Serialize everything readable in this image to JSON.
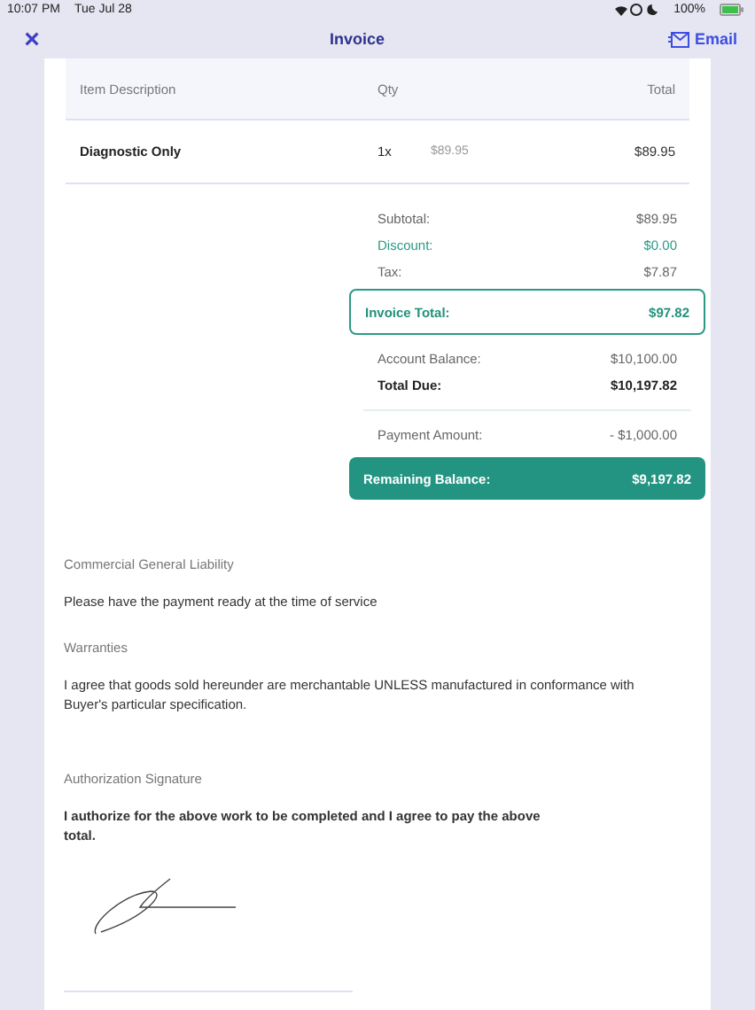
{
  "status_bar": {
    "time": "10:07 PM",
    "date": "Tue Jul 28",
    "battery": "100%"
  },
  "nav": {
    "close": "×",
    "title": "Invoice",
    "action": "Email"
  },
  "table": {
    "columns": [
      "Item Description",
      "Qty",
      "Total"
    ],
    "rows": [
      {
        "description": "Diagnostic Only",
        "qty": "1x",
        "unit_price": "$89.95",
        "total": "$89.95"
      }
    ]
  },
  "summary": [
    {
      "kind": "plain",
      "label": "Subtotal:",
      "value": "$89.95"
    },
    {
      "kind": "discount",
      "label": "Discount:",
      "value": "$0.00"
    },
    {
      "kind": "plain",
      "label": "Tax:",
      "value": "$7.87"
    },
    {
      "kind": "outlined",
      "label": "Invoice Total:",
      "value": "$97.82"
    },
    {
      "kind": "plain",
      "label": "Account Balance:",
      "value": "$10,100.00"
    },
    {
      "kind": "bold",
      "label": "Total Due:",
      "value": "$10,197.82"
    },
    {
      "kind": "divider"
    },
    {
      "kind": "plain",
      "label": "Payment Amount:",
      "value": "- $1,000.00"
    },
    {
      "kind": "filled",
      "label": "Remaining Balance:",
      "value": "$9,197.82"
    }
  ],
  "sections": [
    {
      "heading": "Commercial General Liability",
      "body": "Please have the payment ready at the time of service",
      "emphasis": false
    },
    {
      "heading": "Warranties",
      "body": "I agree that goods sold hereunder are merchantable UNLESS manufactured in conformance with Buyer's particular specification.",
      "emphasis": false
    },
    {
      "heading": "Authorization Signature",
      "body": "I authorize for the above work to be completed and I agree to pay the above total.",
      "emphasis": true
    }
  ]
}
